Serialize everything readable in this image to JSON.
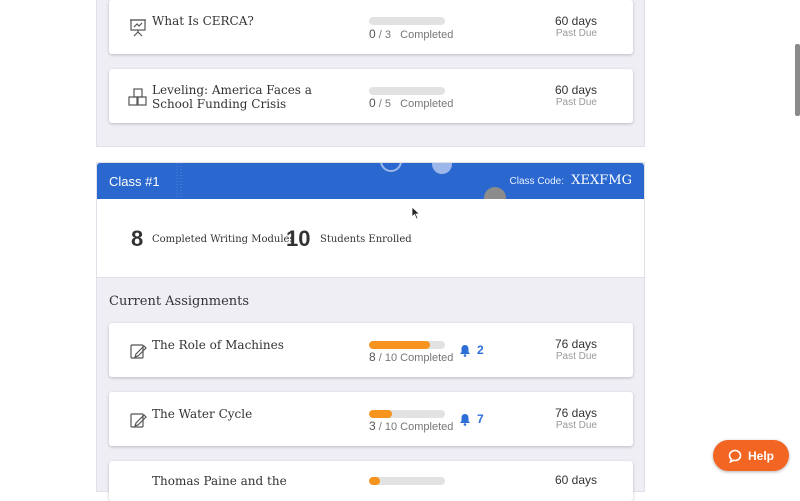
{
  "top_assignments": [
    {
      "title": "What Is CERCA?",
      "done": "0",
      "total": "3",
      "completed_label": "Completed",
      "progress": 0,
      "due_days": "60 days",
      "due_label": "Past Due",
      "icon": "presentation-icon"
    },
    {
      "title": "Leveling: America Faces a School Funding Crisis",
      "done": "0",
      "total": "5",
      "completed_label": "Completed",
      "progress": 0,
      "due_days": "60 days",
      "due_label": "Past Due",
      "icon": "blocks-icon"
    }
  ],
  "class": {
    "title": "Class #1",
    "code_label": "Class Code:",
    "code": "XEXFMG",
    "header_color": "#2a68cf",
    "stats": [
      {
        "value": "8",
        "label": "Completed Writing Modules"
      },
      {
        "value": "10",
        "label": "Students Enrolled"
      }
    ]
  },
  "current": {
    "heading": "Current Assignments",
    "items": [
      {
        "title": "The Role of Machines",
        "done": "8",
        "total": "10",
        "completed_label": "Completed",
        "progress": 0.8,
        "notifications": "2",
        "due_days": "76 days",
        "due_label": "Past Due",
        "icon": "edit-icon"
      },
      {
        "title": "The Water Cycle",
        "done": "3",
        "total": "10",
        "completed_label": "Completed",
        "progress": 0.3,
        "notifications": "7",
        "due_days": "76 days",
        "due_label": "Past Due",
        "icon": "edit-icon"
      },
      {
        "title": "Thomas Paine and the",
        "due_days": "60 days",
        "icon": "edit-icon"
      }
    ]
  },
  "help": {
    "label": "Help",
    "color": "#f26522"
  },
  "colors": {
    "progress": "#f7941d",
    "notification": "#2d6fd6",
    "panel_bg": "#efeef5"
  }
}
